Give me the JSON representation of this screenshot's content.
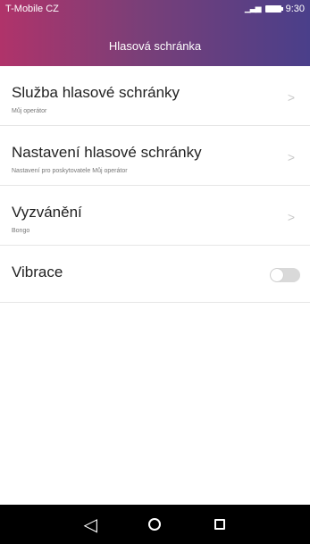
{
  "status": {
    "carrier": "T-Mobile CZ",
    "time": "9:30",
    "signal_icon": "signal-icon",
    "battery_icon": "battery-icon"
  },
  "header": {
    "title": "Hlasová schránka"
  },
  "items": [
    {
      "title": "Služba hlasové schránky",
      "subtitle": "Můj operátor"
    },
    {
      "title": "Nastavení hlasové schránky",
      "subtitle": "Nastavení pro poskytovatele Můj operátor"
    },
    {
      "title": "Vyzvánění",
      "subtitle": "Bongo"
    },
    {
      "title": "Vibrace",
      "toggle_on": false
    }
  ],
  "colors": {
    "header_gradient": [
      "#b0336a",
      "#4a3f8a"
    ]
  },
  "navbar": {
    "back_icon": "back-icon",
    "home_icon": "home-icon",
    "recents_icon": "recents-icon"
  }
}
